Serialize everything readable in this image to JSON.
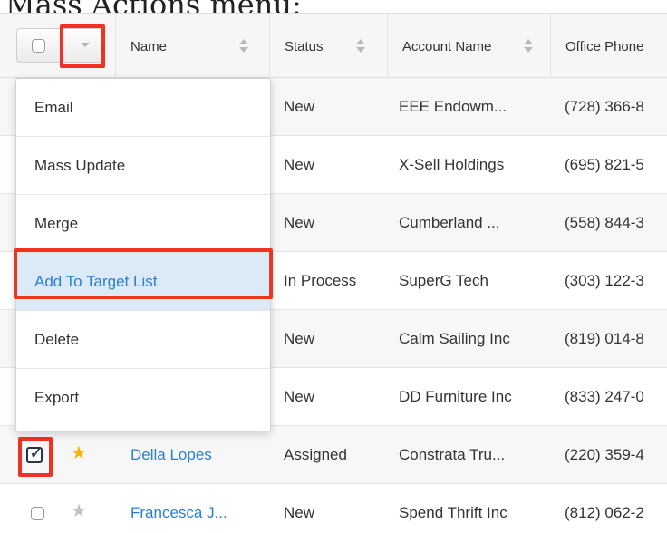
{
  "caption": "Mass Actions menu:",
  "header": {
    "columns": [
      "Name",
      "Status",
      "Account Name",
      "Office Phone"
    ]
  },
  "rows": [
    {
      "name": "",
      "status": "New",
      "account": "EEE Endowm...",
      "phone": "(728) 366-8",
      "starred": false,
      "checked": false
    },
    {
      "name": "",
      "status": "New",
      "account": "X-Sell Holdings",
      "phone": "(695) 821-5",
      "starred": false,
      "checked": false
    },
    {
      "name": "",
      "status": "New",
      "account": "Cumberland ...",
      "phone": "(558) 844-3",
      "starred": false,
      "checked": false
    },
    {
      "name": "",
      "status": "In Process",
      "account": "SuperG Tech",
      "phone": "(303) 122-3",
      "starred": false,
      "checked": false
    },
    {
      "name": "",
      "status": "New",
      "account": "Calm Sailing Inc",
      "phone": "(819) 014-8",
      "starred": false,
      "checked": false
    },
    {
      "name": "",
      "status": "New",
      "account": "DD Furniture Inc",
      "phone": "(833) 247-0",
      "starred": false,
      "checked": false
    },
    {
      "name": "Della Lopes",
      "status": "Assigned",
      "account": "Constrata Tru...",
      "phone": "(220) 359-4",
      "starred": true,
      "checked": true
    },
    {
      "name": "Francesca J...",
      "status": "New",
      "account": "Spend Thrift Inc",
      "phone": "(812) 062-2",
      "starred": false,
      "checked": false
    }
  ],
  "menu": {
    "items": [
      "Email",
      "Mass Update",
      "Merge",
      "Add To Target List",
      "Delete",
      "Export"
    ],
    "active_item": "Add To Target List"
  },
  "colors": {
    "highlight": "#ee3325",
    "link": "#2a7fd0",
    "star_active": "#f5b50a"
  }
}
